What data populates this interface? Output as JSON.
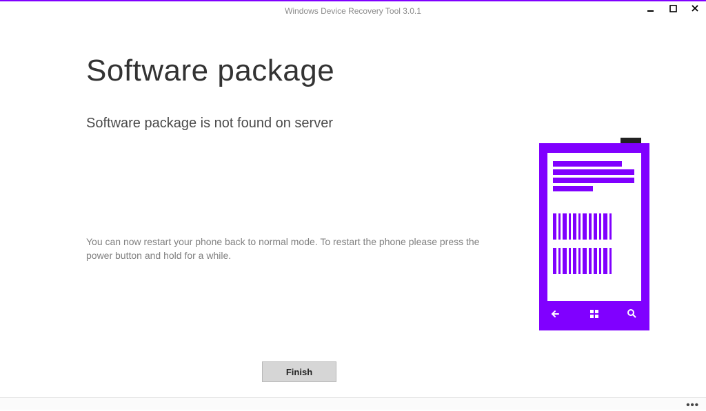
{
  "window": {
    "title": "Windows Device Recovery Tool 3.0.1"
  },
  "page": {
    "title": "Software package",
    "subtitle": "Software package is not found on server",
    "description": "You can now restart your phone back to normal mode. To restart the phone please press the power button and hold for a while."
  },
  "actions": {
    "finish": "Finish"
  },
  "colors": {
    "accent": "#8000ff"
  }
}
